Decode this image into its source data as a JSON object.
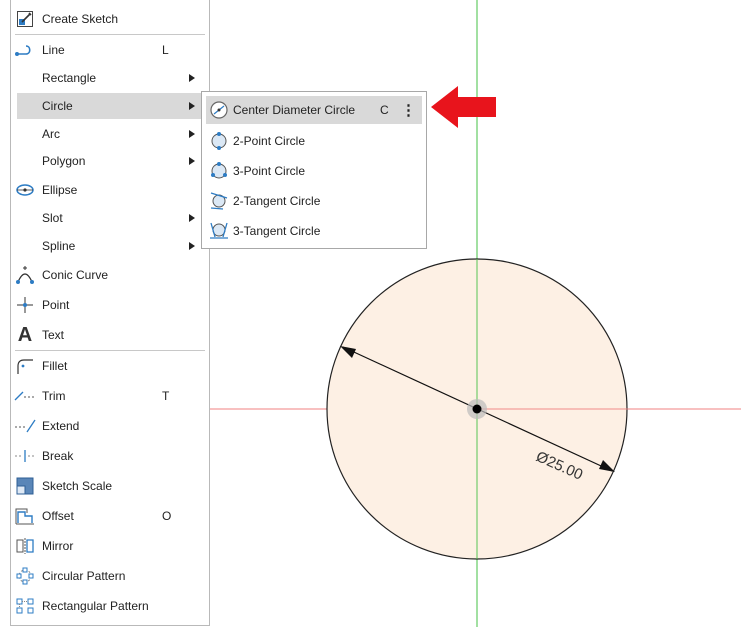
{
  "colors": {
    "accent_blue": "#2d7cc4",
    "highlight": "#d9d9d9",
    "sketch_fill": "#fdf0e4",
    "axis_red": "#f08080",
    "axis_green": "#44c044",
    "callout_red": "#e8141c"
  },
  "menu": {
    "items": [
      {
        "label": "Create Sketch",
        "icon": "create-sketch-icon"
      },
      {
        "label": "Line",
        "shortcut": "L",
        "icon": "line-icon"
      },
      {
        "label": "Rectangle",
        "has_submenu": true
      },
      {
        "label": "Circle",
        "has_submenu": true,
        "highlighted": true
      },
      {
        "label": "Arc",
        "has_submenu": true
      },
      {
        "label": "Polygon",
        "has_submenu": true
      },
      {
        "label": "Ellipse",
        "icon": "ellipse-icon"
      },
      {
        "label": "Slot",
        "has_submenu": true
      },
      {
        "label": "Spline",
        "has_submenu": true
      },
      {
        "label": "Conic Curve",
        "icon": "conic-curve-icon"
      },
      {
        "label": "Point",
        "icon": "point-icon"
      },
      {
        "label": "Text",
        "icon": "text-icon"
      },
      {
        "label": "Fillet",
        "icon": "fillet-icon"
      },
      {
        "label": "Trim",
        "shortcut": "T",
        "icon": "trim-icon"
      },
      {
        "label": "Extend",
        "icon": "extend-icon"
      },
      {
        "label": "Break",
        "icon": "break-icon"
      },
      {
        "label": "Sketch Scale",
        "icon": "sketch-scale-icon"
      },
      {
        "label": "Offset",
        "shortcut": "O",
        "icon": "offset-icon"
      },
      {
        "label": "Mirror",
        "icon": "mirror-icon"
      },
      {
        "label": "Circular Pattern",
        "icon": "circular-pattern-icon"
      },
      {
        "label": "Rectangular Pattern",
        "icon": "rectangular-pattern-icon"
      }
    ]
  },
  "submenu": {
    "items": [
      {
        "label": "Center Diameter Circle",
        "shortcut": "C",
        "more": "⋮",
        "highlighted": true,
        "icon": "center-diameter-circle-icon"
      },
      {
        "label": "2-Point Circle",
        "icon": "two-point-circle-icon"
      },
      {
        "label": "3-Point Circle",
        "icon": "three-point-circle-icon"
      },
      {
        "label": "2-Tangent Circle",
        "icon": "two-tangent-circle-icon"
      },
      {
        "label": "3-Tangent Circle",
        "icon": "three-tangent-circle-icon"
      }
    ]
  },
  "canvas": {
    "dimension_label": "Ø25.00"
  }
}
